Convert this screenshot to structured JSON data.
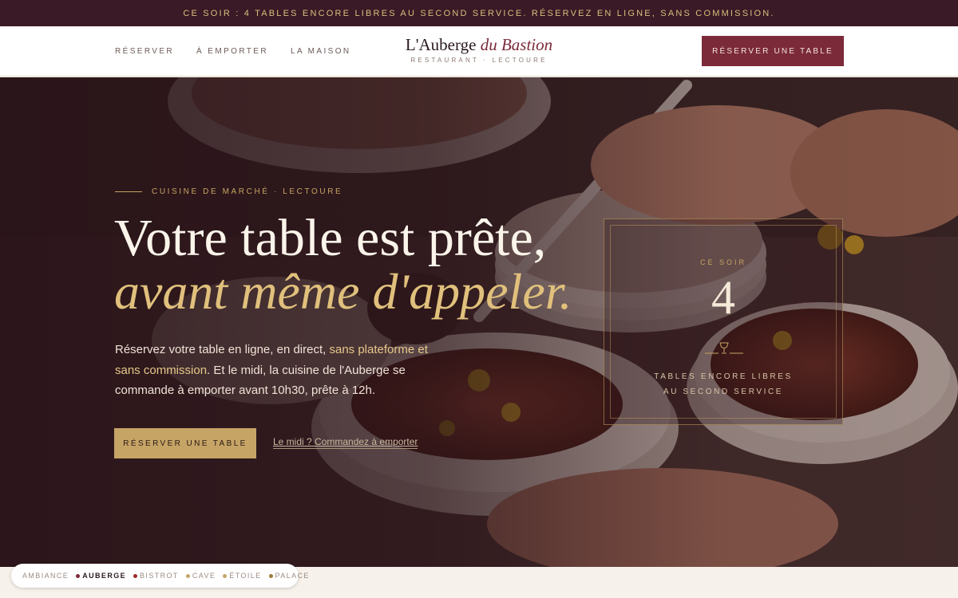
{
  "announcement": "Ce soir : 4 tables encore libres au second service. Réservez en ligne, sans commission.",
  "nav": {
    "items": [
      "Réserver",
      "À emporter",
      "La maison"
    ]
  },
  "logo": {
    "name_regular": "L'Auberge ",
    "name_italic": "du Bastion",
    "subtitle": "Restaurant · Lectoure"
  },
  "header_cta": "Réserver une table",
  "hero": {
    "eyebrow": "Cuisine de marché · Lectoure",
    "title_line1": "Votre table est prête,",
    "title_line2": "avant même d'appeler.",
    "lead_part1": "Réservez votre table en ligne, en direct, ",
    "lead_highlight": "sans plateforme et sans commission",
    "lead_part2": ". Et le midi, la cuisine de l'Auberge se commande à emporter avant 10h30, prête à 12h.",
    "cta_primary": "Réserver une table",
    "cta_secondary": "Le midi ? Commandez à emporter"
  },
  "tonight_card": {
    "label": "Ce soir",
    "count": "4",
    "text_line1": "Tables encore libres",
    "text_line2": "au second service",
    "icon": "wine-glass-icon"
  },
  "themes": {
    "items": [
      {
        "label": "Ambiance",
        "color": "",
        "active": false
      },
      {
        "label": "Auberge",
        "color": "#7b2a3a",
        "active": true
      },
      {
        "label": "Bistrot",
        "color": "#9b2a2a",
        "active": false
      },
      {
        "label": "Cave",
        "color": "#c5a466",
        "active": false
      },
      {
        "label": "Étoile",
        "color": "#c5a466",
        "active": false
      },
      {
        "label": "Palace",
        "color": "#a07a3a",
        "active": false
      }
    ]
  },
  "colors": {
    "brand": "#7b2a3a",
    "gold": "#c5a466",
    "topbar": "#3a1a26"
  }
}
